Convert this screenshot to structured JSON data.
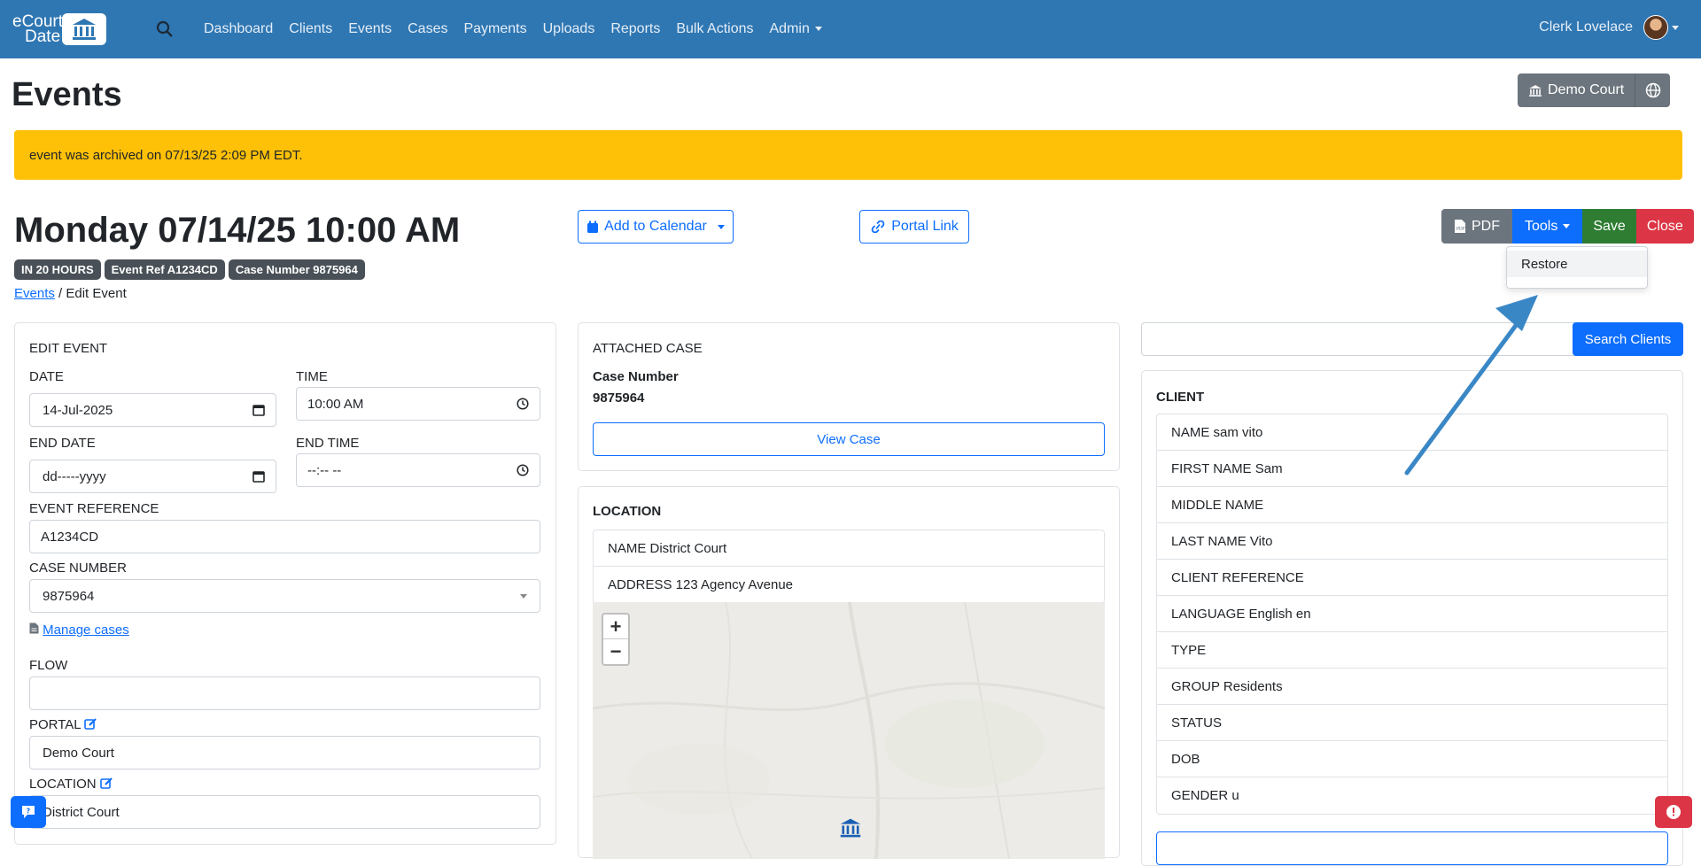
{
  "brand": {
    "line1": "eCourt",
    "line2": "Date"
  },
  "nav": [
    "Dashboard",
    "Clients",
    "Events",
    "Cases",
    "Payments",
    "Uploads",
    "Reports",
    "Bulk Actions",
    "Admin"
  ],
  "user": {
    "name": "Clerk Lovelace"
  },
  "page": {
    "title": "Events",
    "court_button": "Demo Court"
  },
  "alert": {
    "text": "event was archived on 07/13/25 2:09 PM EDT."
  },
  "event": {
    "datetime": "Monday 07/14/25 10:00 AM",
    "badges": [
      "IN 20 HOURS",
      "Event Ref A1234CD",
      "Case Number 9875964"
    ]
  },
  "breadcrumb": {
    "parent": "Events",
    "current": "/ Edit Event"
  },
  "buttons": {
    "add_to_calendar": "Add to Calendar",
    "portal_link": "Portal Link",
    "pdf": "PDF",
    "tools": "Tools",
    "save": "Save",
    "close": "Close",
    "view_case": "View Case",
    "search_clients": "Search Clients"
  },
  "tools_menu": {
    "items": [
      "Restore"
    ]
  },
  "edit_event": {
    "heading": "EDIT EVENT",
    "date_label": "DATE",
    "date_value": "14-Jul-2025",
    "time_label": "TIME",
    "time_value": "10:00  AM",
    "end_date_label": "END DATE",
    "end_date_value": "dd-----yyyy",
    "end_time_label": "END TIME",
    "end_time_value": "--:-- --",
    "event_ref_label": "EVENT REFERENCE",
    "event_ref_value": "A1234CD",
    "case_number_label": "CASE NUMBER",
    "case_number_value": "9875964",
    "manage_cases": "Manage cases",
    "flow_label": "FLOW",
    "flow_value": "",
    "portal_label": "PORTAL",
    "portal_value": "Demo Court",
    "location_label": "LOCATION",
    "location_value": "District Court"
  },
  "attached_case": {
    "heading": "ATTACHED CASE",
    "case_number_label": "Case Number",
    "case_number_value": "9875964"
  },
  "location": {
    "heading": "LOCATION",
    "rows": [
      "NAME District Court",
      "ADDRESS 123 Agency Avenue"
    ],
    "zoom_in": "+",
    "zoom_out": "−"
  },
  "client": {
    "heading": "CLIENT",
    "rows": [
      "NAME sam vito",
      "FIRST NAME Sam",
      "MIDDLE NAME",
      "LAST NAME Vito",
      "CLIENT REFERENCE",
      "LANGUAGE English en",
      "TYPE",
      "GROUP Residents",
      "STATUS",
      "DOB",
      "GENDER u"
    ]
  },
  "colors": {
    "navbar": "#2f77b3",
    "alert": "#ffc107",
    "primary": "#0d6efd",
    "save": "#2e7d32",
    "danger": "#dc3545",
    "arrow": "#3a87c6"
  }
}
